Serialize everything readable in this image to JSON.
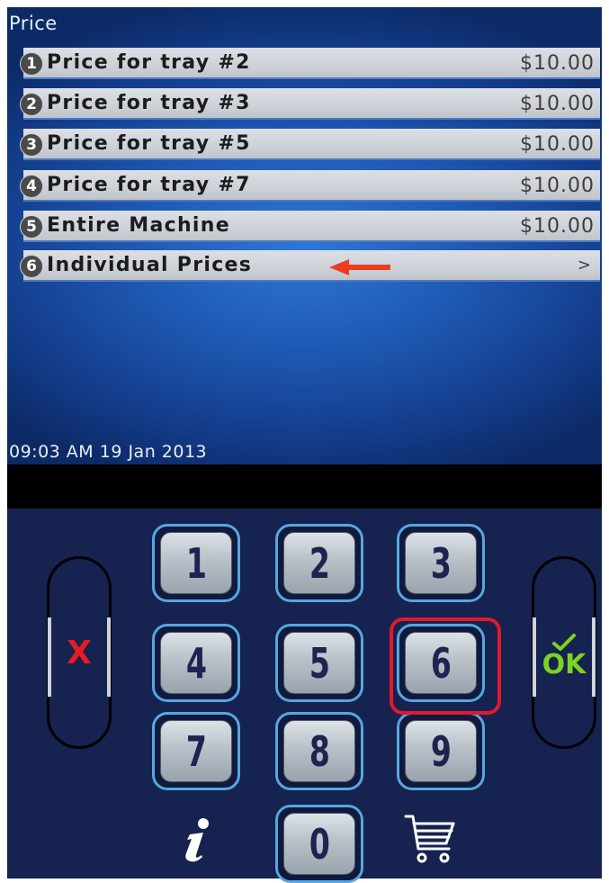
{
  "screen": {
    "title": "Price",
    "datetime": "09:03 AM 19 Jan 2013"
  },
  "menu": {
    "items": [
      {
        "number": "1",
        "label": "Price for tray #2",
        "value": "$10.00"
      },
      {
        "number": "2",
        "label": "Price for tray #3",
        "value": "$10.00"
      },
      {
        "number": "3",
        "label": "Price for tray #5",
        "value": "$10.00"
      },
      {
        "number": "4",
        "label": "Price for tray #7",
        "value": "$10.00"
      },
      {
        "number": "5",
        "label": "Entire Machine",
        "value": "$10.00"
      },
      {
        "number": "6",
        "label": "Individual Prices",
        "chevron": ">"
      }
    ]
  },
  "keypad": {
    "keys": [
      "1",
      "2",
      "3",
      "4",
      "5",
      "6",
      "7",
      "8",
      "9",
      "0"
    ],
    "highlighted_key": "6",
    "cancel_label": "X",
    "ok_label": "OK"
  },
  "icons": {
    "info": "info-icon",
    "cart": "shopping-cart-icon",
    "ok_check": "checkmark-icon",
    "arrow": "left-arrow-icon"
  },
  "colors": {
    "highlight": "#e2182b",
    "arrow": "#ee3b22",
    "cancel": "#e41c23",
    "ok": "#7ed321",
    "key_border": "#56a7df",
    "screen_blue": "#1d56b0",
    "keypad_bg": "#16224f"
  }
}
